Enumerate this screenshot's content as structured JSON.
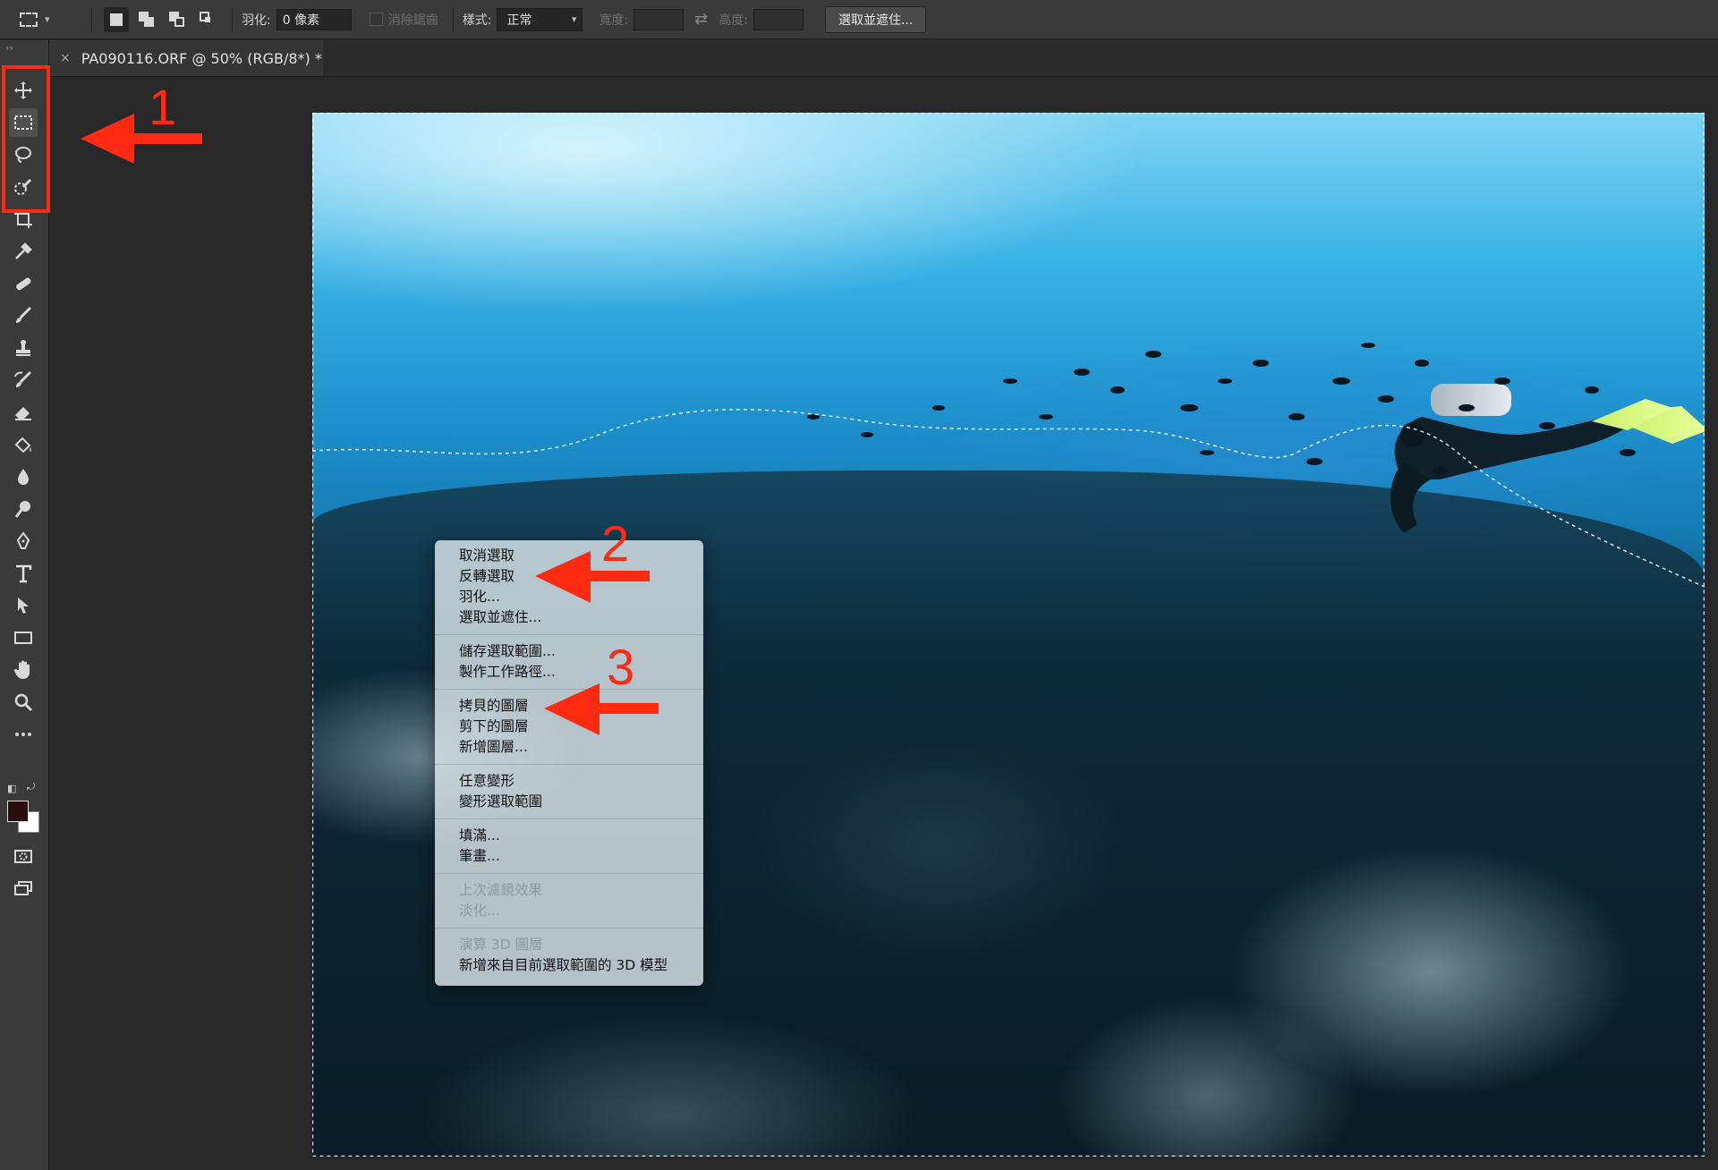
{
  "options_bar": {
    "feather_label": "羽化:",
    "feather_value": "0 像素",
    "anti_alias_label": "消除鋸齒",
    "style_label": "樣式:",
    "style_value": "正常",
    "width_label": "寬度:",
    "height_label": "高度:",
    "select_mask_button": "選取並遮住..."
  },
  "document_tab": {
    "title": "PA090116.ORF @ 50% (RGB/8*) *"
  },
  "toolbar": {
    "tools": [
      "move-tool",
      "rect-marquee-tool",
      "lasso-tool",
      "quick-selection-tool",
      "crop-tool",
      "eyedropper-tool",
      "healing-brush-tool",
      "brush-tool",
      "clone-stamp-tool",
      "history-brush-tool",
      "eraser-tool",
      "paint-bucket-tool",
      "blur-tool",
      "dodge-tool",
      "pen-tool",
      "type-tool",
      "path-selection-tool",
      "rectangle-tool",
      "hand-tool",
      "zoom-tool",
      "edit-toolbar",
      "quick-mask",
      "screen-mode"
    ],
    "foreground_color": "#2a0d10",
    "background_color": "#ffffff"
  },
  "context_menu": {
    "groups": [
      [
        {
          "label": "取消選取",
          "disabled": false
        },
        {
          "label": "反轉選取",
          "disabled": false
        },
        {
          "label": "羽化...",
          "disabled": false
        },
        {
          "label": "選取並遮住...",
          "disabled": false
        }
      ],
      [
        {
          "label": "儲存選取範圍...",
          "disabled": false
        },
        {
          "label": "製作工作路徑...",
          "disabled": false
        }
      ],
      [
        {
          "label": "拷貝的圖層",
          "disabled": false
        },
        {
          "label": "剪下的圖層",
          "disabled": false
        },
        {
          "label": "新增圖層...",
          "disabled": false
        }
      ],
      [
        {
          "label": "任意變形",
          "disabled": false
        },
        {
          "label": "變形選取範圍",
          "disabled": false
        }
      ],
      [
        {
          "label": "填滿...",
          "disabled": false
        },
        {
          "label": "筆畫...",
          "disabled": false
        }
      ],
      [
        {
          "label": "上次濾鏡效果",
          "disabled": true
        },
        {
          "label": "淡化...",
          "disabled": true
        }
      ],
      [
        {
          "label": "演算 3D 圖層",
          "disabled": true
        },
        {
          "label": "新增來自目前選取範圍的 3D 模型",
          "disabled": false
        }
      ]
    ]
  },
  "annotations": {
    "one": "1",
    "two": "2",
    "three": "3",
    "color": "#ff2a12"
  }
}
